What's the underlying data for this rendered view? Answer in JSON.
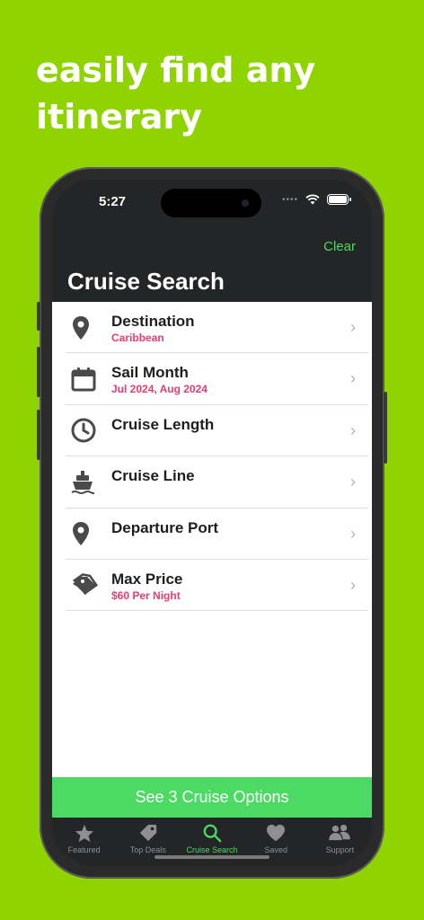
{
  "headline": "easily find any itinerary",
  "status": {
    "time": "5:27",
    "signal_dots": "••••"
  },
  "nav": {
    "clear_label": "Clear",
    "title": "Cruise Search"
  },
  "rows": [
    {
      "label": "Destination",
      "value": "Caribbean",
      "icon": "location-pin-icon"
    },
    {
      "label": "Sail Month",
      "value": "Jul 2024, Aug 2024",
      "icon": "calendar-icon"
    },
    {
      "label": "Cruise Length",
      "value": "",
      "icon": "clock-icon"
    },
    {
      "label": "Cruise Line",
      "value": "",
      "icon": "ship-icon"
    },
    {
      "label": "Departure Port",
      "value": "",
      "icon": "location-pin-icon"
    },
    {
      "label": "Max Price",
      "value": "$60 Per Night",
      "icon": "price-tag-icon"
    }
  ],
  "chevron": "›",
  "cta_label": "See 3 Cruise Options",
  "tabs": [
    {
      "label": "Featured",
      "icon": "star-icon",
      "active": false
    },
    {
      "label": "Top Deals",
      "icon": "tag-icon",
      "active": false
    },
    {
      "label": "Cruise Search",
      "icon": "search-icon",
      "active": true
    },
    {
      "label": "Saved",
      "icon": "heart-icon",
      "active": false
    },
    {
      "label": "Support",
      "icon": "people-icon",
      "active": false
    }
  ],
  "colors": {
    "background": "#8fd400",
    "accent_green": "#4cd964",
    "value_pink": "#ee3a72",
    "nav_dark": "#232527"
  }
}
